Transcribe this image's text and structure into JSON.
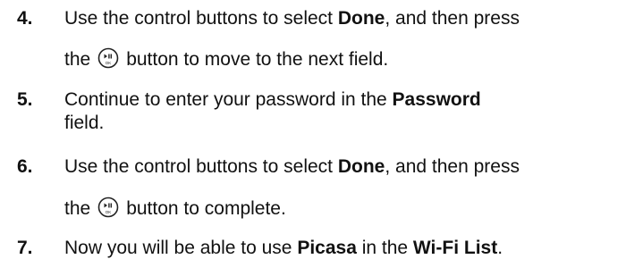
{
  "steps": [
    {
      "number": "4.",
      "line1": {
        "a": "Use the control buttons to select ",
        "bold": "Done",
        "b": ", and then press"
      },
      "line2": {
        "a": "the",
        "b": "button to move to the next field."
      },
      "icon": "play-pause-ok-button-icon"
    },
    {
      "number": "5.",
      "line1": {
        "a": "Continue to enter your password in the ",
        "bold": "Password"
      },
      "line2": {
        "a": "field."
      }
    },
    {
      "number": "6.",
      "line1": {
        "a": "Use the control buttons to select ",
        "bold": "Done",
        "b": ", and then press"
      },
      "line2": {
        "a": "the",
        "b": "button to complete."
      },
      "icon": "play-pause-ok-button-icon"
    },
    {
      "number": "7.",
      "line1": {
        "a": "Now you will be able to use ",
        "bold1": "Picasa",
        "b": " in the ",
        "bold2": "Wi-Fi List",
        "c": "."
      }
    }
  ]
}
